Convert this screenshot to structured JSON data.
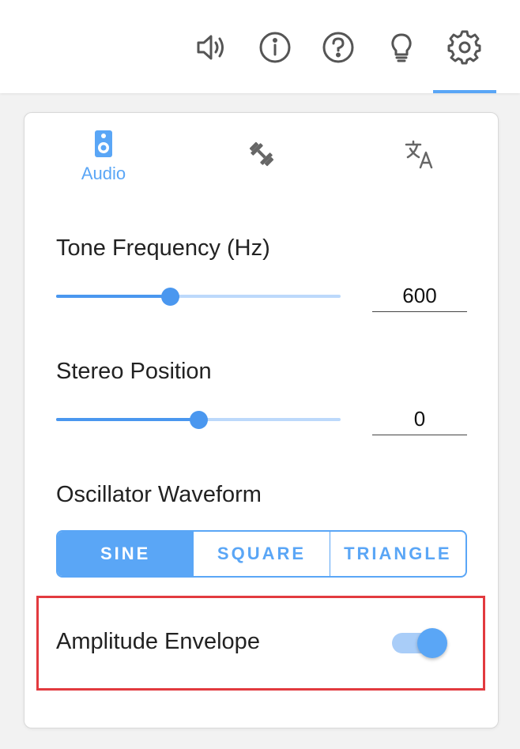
{
  "topbar": {
    "icons": [
      "speaker-icon",
      "info-icon",
      "help-icon",
      "lightbulb-icon",
      "gear-icon"
    ],
    "active_icon": "gear-icon"
  },
  "panel": {
    "tabs": [
      {
        "icon": "speaker-device-icon",
        "label": "Audio",
        "active": true
      },
      {
        "icon": "dumbbell-icon",
        "label": "",
        "active": false
      },
      {
        "icon": "translate-icon",
        "label": "",
        "active": false
      }
    ],
    "tone_frequency": {
      "label": "Tone Frequency (Hz)",
      "value": "600",
      "slider_fraction": 0.4
    },
    "stereo_position": {
      "label": "Stereo Position",
      "value": "0",
      "slider_fraction": 0.5
    },
    "oscillator_waveform": {
      "label": "Oscillator Waveform",
      "options": [
        "SINE",
        "SQUARE",
        "TRIANGLE"
      ],
      "selected": "SINE"
    },
    "amplitude_envelope": {
      "label": "Amplitude Envelope",
      "enabled": true
    }
  },
  "colors": {
    "accent": "#5aa6f6",
    "slider": "#4a97ef",
    "highlight": "#e23a3f",
    "icon_gray": "#555555"
  }
}
